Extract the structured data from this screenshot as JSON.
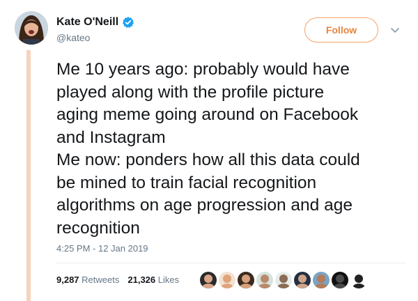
{
  "author": {
    "name": "Kate O'Neill",
    "handle": "@kateo"
  },
  "follow_label": "Follow",
  "tweet_lines": [
    "Me 10 years ago: probably would have",
    "played along with the profile picture",
    "aging meme going around on Facebook",
    "and Instagram",
    "Me now: ponders how all this data could",
    "be mined to train facial recognition",
    "algorithms on age progression and age",
    "recognition"
  ],
  "timestamp": "4:25 PM - 12 Jan 2019",
  "retweets": {
    "count": "9,287",
    "label": "Retweets"
  },
  "likes": {
    "count": "21,326",
    "label": "Likes"
  },
  "liker_avatars": [
    {
      "bg": "#2b2b2b",
      "face": "#d9a68a"
    },
    {
      "bg": "#f3e2d3",
      "face": "#e0a47c"
    },
    {
      "bg": "#3a2a20",
      "face": "#d6a07a"
    },
    {
      "bg": "#d7e3df",
      "face": "#b98a6a"
    },
    {
      "bg": "#e8ece9",
      "face": "#8a6b55"
    },
    {
      "bg": "#243042",
      "face": "#cfa489"
    },
    {
      "bg": "#7aa3c4",
      "face": "#b57b5a"
    },
    {
      "bg": "#111111",
      "face": "#4a4a4a"
    },
    {
      "bg": "#ffffff",
      "face": "#222222"
    }
  ],
  "colors": {
    "follow_accent": "#e8843c",
    "rail": "#f7d3bd",
    "verified": "#1da1f2"
  }
}
